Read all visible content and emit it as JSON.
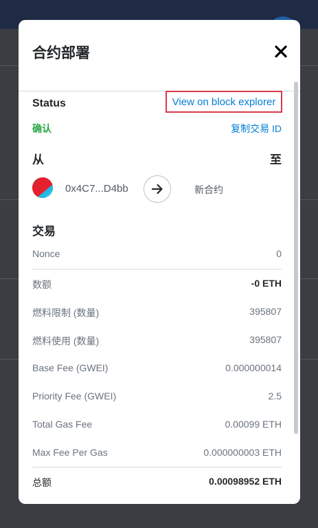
{
  "modal": {
    "title": "合约部署",
    "status_label": "Status",
    "explorer_link": "View on block explorer",
    "status_value": "确认",
    "copy_tx_id": "复制交易 ID",
    "from_label": "从",
    "to_label": "至",
    "from_address": "0x4C7...D4bb",
    "to_value": "新合约",
    "tx_label": "交易",
    "details": [
      {
        "label": "Nonce",
        "value": "0"
      },
      {
        "label": "数额",
        "value": "-0 ETH"
      },
      {
        "label": "燃料限制 (数量)",
        "value": "395807"
      },
      {
        "label": "燃料使用 (数量)",
        "value": "395807"
      },
      {
        "label": "Base Fee (GWEI)",
        "value": "0.000000014"
      },
      {
        "label": "Priority Fee (GWEI)",
        "value": "2.5"
      },
      {
        "label": "Total Gas Fee",
        "value": "0.00099 ETH"
      },
      {
        "label": "Max Fee Per Gas",
        "value": "0.000000003 ETH"
      },
      {
        "label": "总额",
        "value": "0.00098952 ETH"
      }
    ]
  },
  "colors": {
    "link": "#037dd6",
    "success": "#28a745",
    "highlight_border": "#d73a49"
  },
  "icons": {
    "close": "close-icon",
    "arrow": "arrow-right-icon",
    "avatar": "account-identicon"
  }
}
